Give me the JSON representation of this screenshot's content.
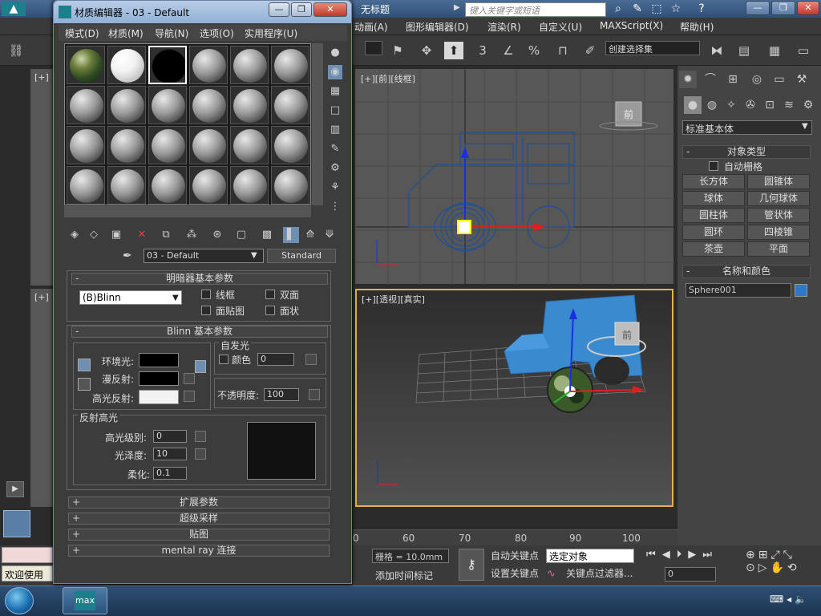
{
  "app": {
    "title": "无标题",
    "search_placeholder": "键入关键字或短语",
    "menu": [
      "动画(A)",
      "图形编辑器(D)",
      "渲染(R)",
      "自定义(U)",
      "MAXScript(X)",
      "帮助(H)"
    ],
    "selection_set": "创建选择集"
  },
  "viewports": {
    "front_label": "[+][前][线框]",
    "persp_label": "[+][透视][真实]",
    "viewcube_front": "前",
    "left_top_label": "[+]",
    "left_bot_label": "[+]"
  },
  "command_panel": {
    "primitive_type": "标准基本体",
    "object_type_title": "对象类型",
    "auto_grid": "自动栅格",
    "objects": [
      "长方体",
      "圆锥体",
      "球体",
      "几何球体",
      "圆柱体",
      "管状体",
      "圆环",
      "四棱锥",
      "茶壶",
      "平面"
    ],
    "name_color_title": "名称和颜色",
    "object_name": "Sphere001",
    "object_color": "#2d78c8"
  },
  "timeline": {
    "ticks": [
      "0",
      "60",
      "70",
      "80",
      "90",
      "100"
    ]
  },
  "status": {
    "grid": "栅格 = 10.0mm",
    "auto_key": "自动关键点",
    "set_key": "设置关键点",
    "selected_object": "选定对象",
    "key_filter": "关键点过滤器...",
    "add_time_tag": "添加时间标记",
    "frame": "0",
    "welcome": "欢迎使用"
  },
  "material_editor": {
    "title": "材质编辑器 - 03 - Default",
    "menu": [
      "模式(D)",
      "材质(M)",
      "导航(N)",
      "选项(O)",
      "实用程序(U)"
    ],
    "material_name": "03 - Default",
    "material_type": "Standard",
    "shader_basic": {
      "title": "明暗器基本参数",
      "shader": "(B)Blinn",
      "wire": "线框",
      "two_sided": "双面",
      "face_map": "面贴图",
      "faceted": "面状"
    },
    "blinn_basic": {
      "title": "Blinn 基本参数",
      "self_illum": "自发光",
      "color": "颜色",
      "self_illum_value": "0",
      "ambient": "环境光:",
      "diffuse": "漫反射:",
      "specular": "高光反射:",
      "opacity_label": "不透明度:",
      "opacity": "100",
      "ambient_color": "#000000",
      "diffuse_color": "#000000",
      "specular_color": "#f2f2f2"
    },
    "spec_highlights": {
      "title": "反射高光",
      "level_label": "高光级别:",
      "level": "0",
      "gloss_label": "光泽度:",
      "gloss": "10",
      "soften_label": "柔化:",
      "soften": "0.1"
    },
    "collapsed": [
      "扩展参数",
      "超级采样",
      "贴图",
      "mental ray 连接"
    ]
  }
}
